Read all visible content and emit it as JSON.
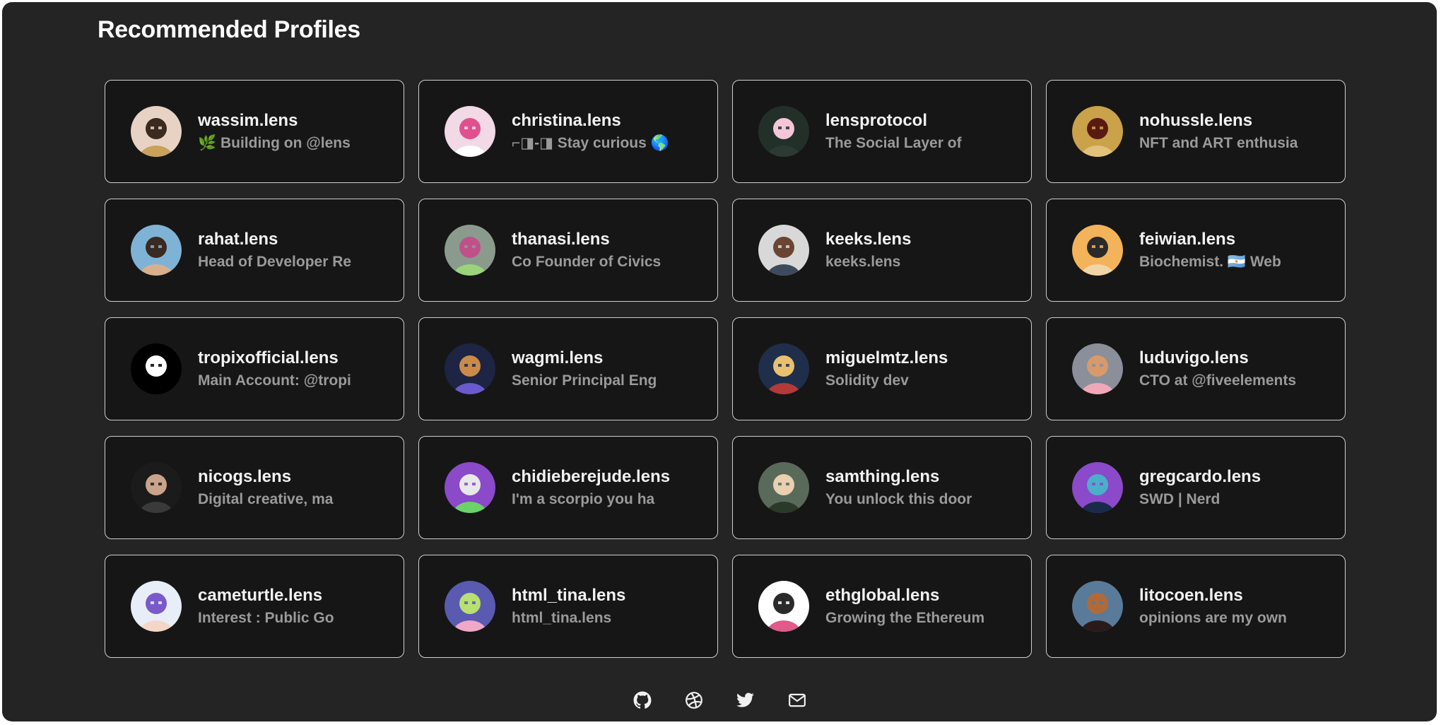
{
  "page": {
    "title": "Recommended Profiles"
  },
  "profiles": [
    {
      "handle": "wassim.lens",
      "bio": "🌿 Building on @lens",
      "avatar": {
        "bg": "#e8d2c4",
        "fg": "#3a2a1f",
        "accent": "#c9a15a"
      }
    },
    {
      "handle": "christina.lens",
      "bio": "⌐◨-◨ Stay curious 🌎",
      "avatar": {
        "bg": "#f1d9e6",
        "fg": "#e0508f",
        "accent": "#ffffff"
      }
    },
    {
      "handle": "lensprotocol",
      "bio": "The Social Layer of",
      "avatar": {
        "bg": "#23302a",
        "fg": "#f5c6d8",
        "accent": "#2b3a33"
      }
    },
    {
      "handle": "nohussle.lens",
      "bio": "NFT and ART enthusia",
      "avatar": {
        "bg": "#c9a24a",
        "fg": "#5a1a12",
        "accent": "#e2c27a"
      }
    },
    {
      "handle": "rahat.lens",
      "bio": "Head of Developer Re",
      "avatar": {
        "bg": "#7fb3d5",
        "fg": "#3a2a22",
        "accent": "#d9b08c"
      }
    },
    {
      "handle": "thanasi.lens",
      "bio": "Co Founder of Civics",
      "avatar": {
        "bg": "#8a9b8e",
        "fg": "#c0508a",
        "accent": "#9bd37a"
      }
    },
    {
      "handle": "keeks.lens",
      "bio": "keeks.lens",
      "avatar": {
        "bg": "#d8d8d8",
        "fg": "#6a4632",
        "accent": "#3c4b5c"
      }
    },
    {
      "handle": "feiwian.lens",
      "bio": "Biochemist. 🇦🇷 Web",
      "avatar": {
        "bg": "#f3b35a",
        "fg": "#2a2a2a",
        "accent": "#f1d4a8"
      }
    },
    {
      "handle": "tropixofficial.lens",
      "bio": "Main Account: @tropi",
      "avatar": {
        "bg": "#000000",
        "fg": "#ffffff",
        "accent": "#000000"
      }
    },
    {
      "handle": "wagmi.lens",
      "bio": "Senior Principal Eng",
      "avatar": {
        "bg": "#1d2444",
        "fg": "#c98a4a",
        "accent": "#6a5acd"
      }
    },
    {
      "handle": "miguelmtz.lens",
      "bio": "Solidity dev",
      "avatar": {
        "bg": "#1f2e4a",
        "fg": "#e8c070",
        "accent": "#b23a3a"
      }
    },
    {
      "handle": "luduvigo.lens",
      "bio": "CTO at @fiveelements",
      "avatar": {
        "bg": "#8a8f9a",
        "fg": "#d89a6a",
        "accent": "#f0a8b8"
      }
    },
    {
      "handle": "nicogs.lens",
      "bio": "Digital creative, ma",
      "avatar": {
        "bg": "#1b1b1b",
        "fg": "#c9a48a",
        "accent": "#3a3a3a"
      }
    },
    {
      "handle": "chidieberejude.lens",
      "bio": "I'm a scorpio you ha",
      "avatar": {
        "bg": "#8a4ac9",
        "fg": "#e8e8e8",
        "accent": "#6ad36a"
      }
    },
    {
      "handle": "samthing.lens",
      "bio": "You unlock this door",
      "avatar": {
        "bg": "#5a6a5a",
        "fg": "#e8d0b0",
        "accent": "#2a3a2a"
      }
    },
    {
      "handle": "gregcardo.lens",
      "bio": "SWD | Nerd",
      "avatar": {
        "bg": "#8a4ac9",
        "fg": "#4ab0c9",
        "accent": "#1a2a4a"
      }
    },
    {
      "handle": "cameturtle.lens",
      "bio": "Interest : Public Go",
      "avatar": {
        "bg": "#e8eef8",
        "fg": "#7a5ac9",
        "accent": "#f4d6c8"
      }
    },
    {
      "handle": "html_tina.lens",
      "bio": "html_tina.lens",
      "avatar": {
        "bg": "#5a5ab0",
        "fg": "#b8e070",
        "accent": "#f0a8c8"
      }
    },
    {
      "handle": "ethglobal.lens",
      "bio": "Growing the Ethereum",
      "avatar": {
        "bg": "#ffffff",
        "fg": "#2a2a2a",
        "accent": "#e05a8a"
      }
    },
    {
      "handle": "litocoen.lens",
      "bio": "opinions are my own",
      "avatar": {
        "bg": "#5a7a9a",
        "fg": "#b06a3a",
        "accent": "#2a1a1a"
      }
    }
  ],
  "footer": {
    "icons": [
      "github-icon",
      "dribbble-icon",
      "twitter-icon",
      "mail-icon"
    ]
  }
}
